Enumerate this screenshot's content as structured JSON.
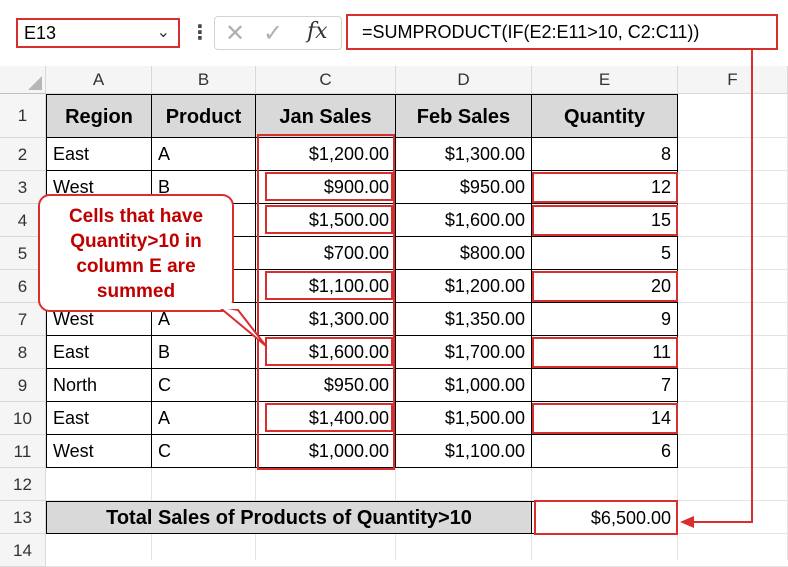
{
  "formula_bar": {
    "name_box": "E13",
    "formula": "=SUMPRODUCT(IF(E2:E11>10, C2:C11))"
  },
  "columns": [
    "A",
    "B",
    "C",
    "D",
    "E",
    "F"
  ],
  "rows": [
    "1",
    "2",
    "3",
    "4",
    "5",
    "6",
    "7",
    "8",
    "9",
    "10",
    "11",
    "12",
    "13",
    "14"
  ],
  "table": {
    "headers": [
      "Region",
      "Product",
      "Jan Sales",
      "Feb Sales",
      "Quantity"
    ],
    "rows": [
      [
        "East",
        "A",
        "$1,200.00",
        "$1,300.00",
        "8"
      ],
      [
        "West",
        "B",
        "$900.00",
        "$950.00",
        "12"
      ],
      [
        "",
        "",
        "$1,500.00",
        "$1,600.00",
        "15"
      ],
      [
        "",
        "",
        "$700.00",
        "$800.00",
        "5"
      ],
      [
        "",
        "",
        "$1,100.00",
        "$1,200.00",
        "20"
      ],
      [
        "West",
        "A",
        "$1,300.00",
        "$1,350.00",
        "9"
      ],
      [
        "East",
        "B",
        "$1,600.00",
        "$1,700.00",
        "11"
      ],
      [
        "North",
        "C",
        "$950.00",
        "$1,000.00",
        "7"
      ],
      [
        "East",
        "A",
        "$1,400.00",
        "$1,500.00",
        "14"
      ],
      [
        "West",
        "C",
        "$1,000.00",
        "$1,100.00",
        "6"
      ]
    ]
  },
  "total": {
    "label": "Total Sales of Products of Quantity>10",
    "value": "$6,500.00"
  },
  "callout": {
    "line1": "Cells that have",
    "line2": "Quantity>10 in",
    "line3": "column E are",
    "line4": "summed"
  },
  "colors": {
    "highlight": "#d92e2e",
    "header_fill": "#d9d9d9",
    "callout_text": "#c00000"
  }
}
